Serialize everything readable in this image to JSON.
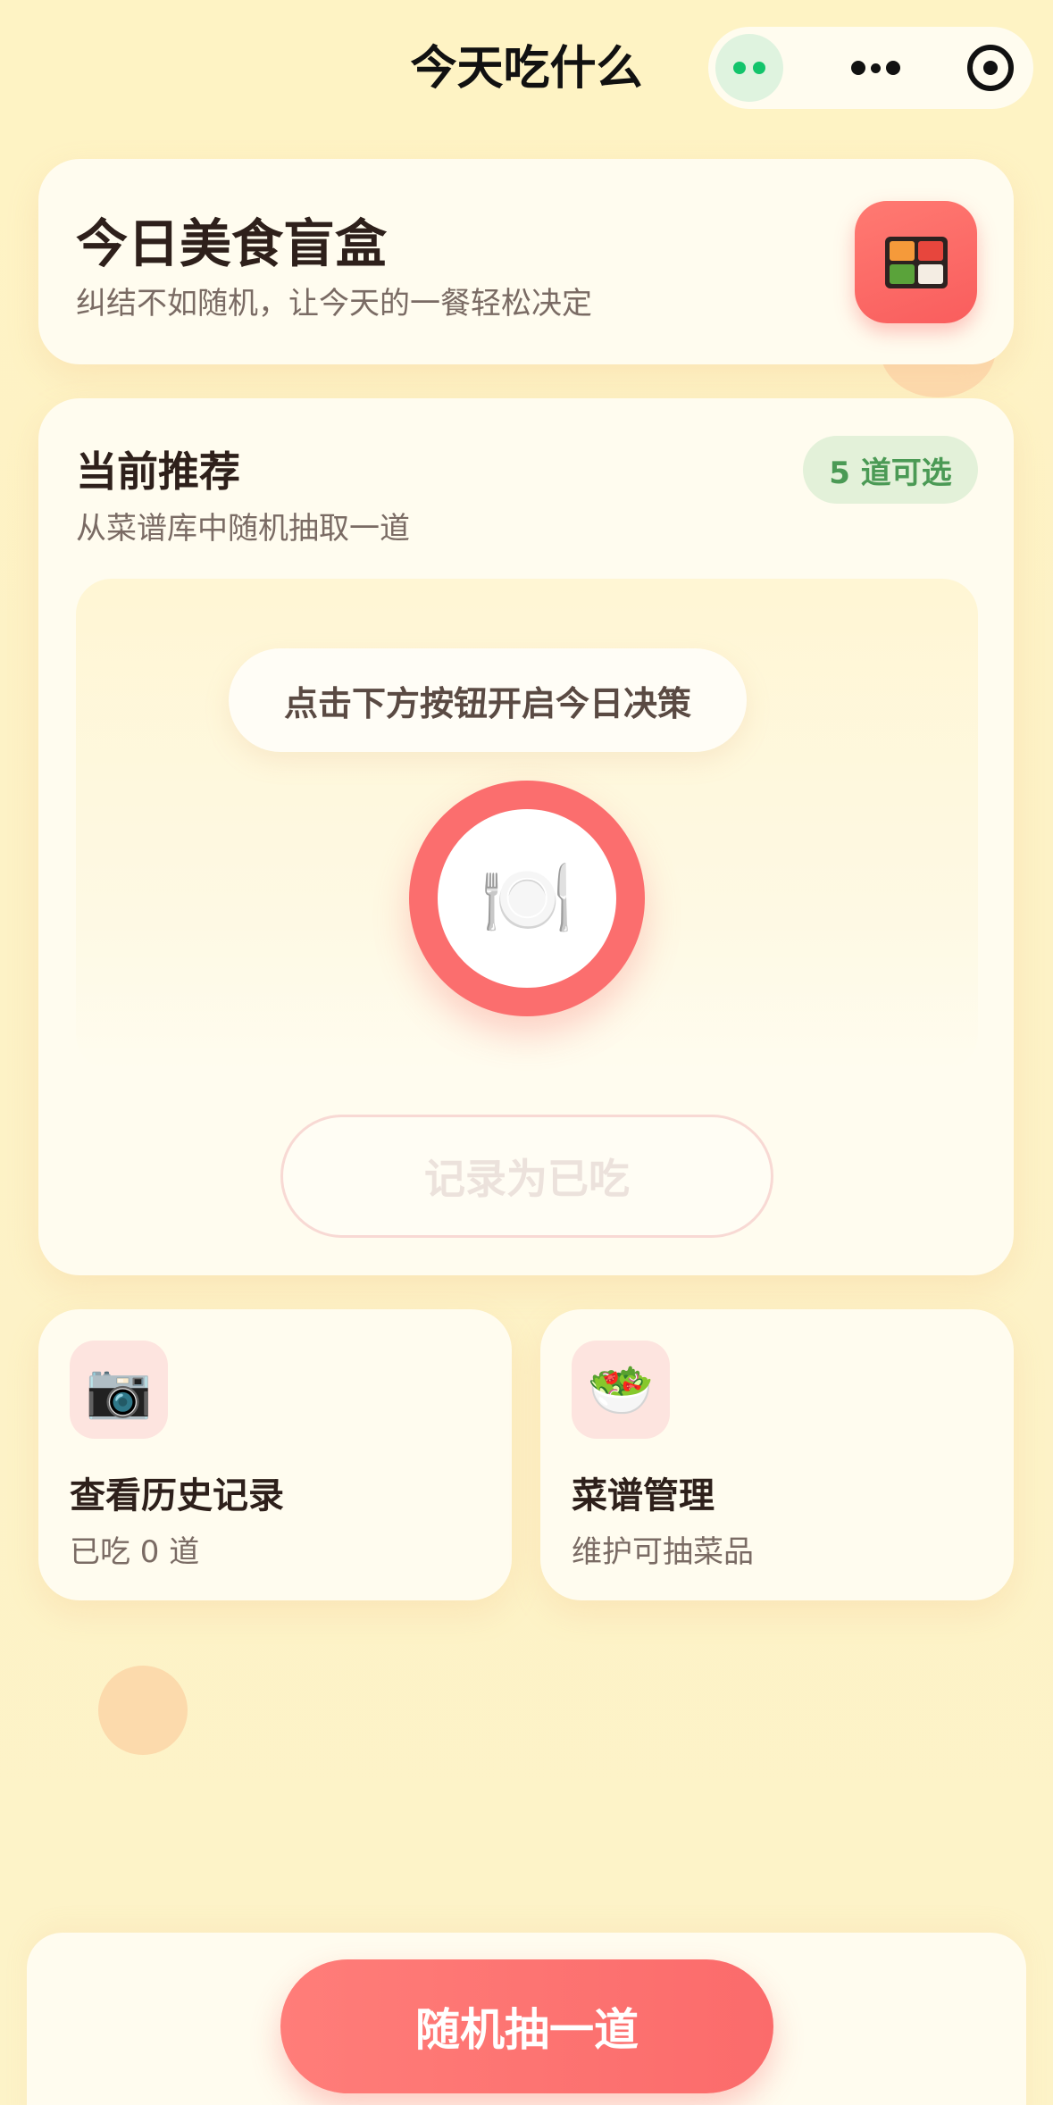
{
  "nav": {
    "title": "今天吃什么",
    "capsule": {
      "status_icon": "online-dots-icon",
      "more_icon": "more-icon",
      "close_icon": "target-close-icon"
    }
  },
  "hero": {
    "title": "今日美食盲盒",
    "subtitle": "纠结不如随机，让今天的一餐轻松决定",
    "icon": "bento-box-icon"
  },
  "recommend": {
    "title": "当前推荐",
    "subtitle": "从菜谱库中随机抽取一道",
    "badge": "5 道可选",
    "hint": "点击下方按钮开启今日决策",
    "plate_icon": "🍽️",
    "mark_label": "记录为已吃"
  },
  "features": [
    {
      "title": "查看历史记录",
      "subtitle": "已吃 0 道",
      "icon": "📷"
    },
    {
      "title": "菜谱管理",
      "subtitle": "维护可抽菜品",
      "icon": "🥗"
    }
  ],
  "bottom": {
    "draw_label": "随机抽一道"
  },
  "colors": {
    "background": "#fdf2c6",
    "accent": "#fb6e6e",
    "badge_bg": "#e3f1d9",
    "badge_text": "#4b9a55",
    "card_bg": "#fffcef"
  }
}
